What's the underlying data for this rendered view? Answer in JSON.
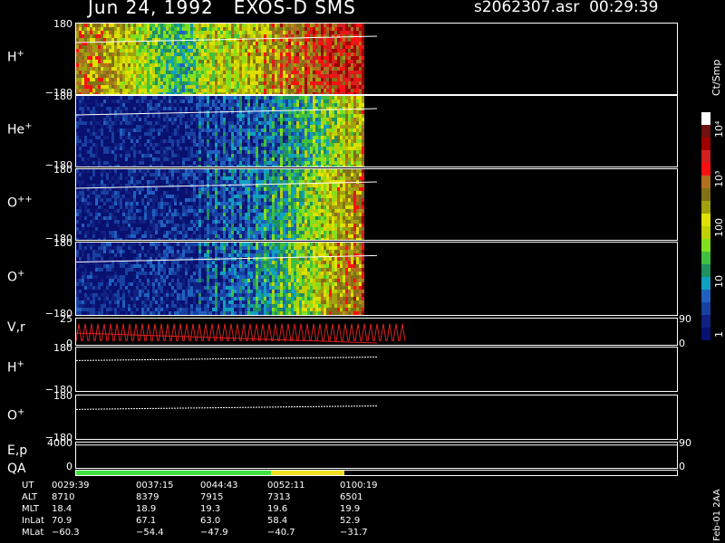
{
  "header": {
    "title": "Jun 24, 1992   EXOS-D SMS",
    "file": "s2062307.asr",
    "time": "00:29:39"
  },
  "panels": [
    {
      "id": "h-plus-top",
      "label": "H",
      "sup": "+",
      "ymax": "180",
      "ymin": "−180"
    },
    {
      "id": "he-plus",
      "label": "He",
      "sup": "+",
      "ymax": "180",
      "ymin": "−180"
    },
    {
      "id": "o-plusplus",
      "label": "O",
      "sup": "++",
      "ymax": "180",
      "ymin": "−180"
    },
    {
      "id": "o-plus-top",
      "label": "O",
      "sup": "+",
      "ymax": "180",
      "ymin": "−180"
    },
    {
      "id": "vr",
      "label": "V,r",
      "sup": "",
      "ymax": "25",
      "ymin": "0",
      "rmax": "90",
      "rmin": "0"
    },
    {
      "id": "h-plus-bot",
      "label": "H",
      "sup": "+",
      "ymax": "180",
      "ymin": "−180"
    },
    {
      "id": "o-plus-bot",
      "label": "O",
      "sup": "+",
      "ymax": "180",
      "ymin": "−180"
    },
    {
      "id": "ep",
      "label": "E,p",
      "sup": "",
      "ymax": "4000",
      "ymin": "0",
      "rmax": "90",
      "rmin": "0"
    },
    {
      "id": "qa",
      "label": "QA",
      "sup": "",
      "ymax": "",
      "ymin": ""
    }
  ],
  "colorbar": {
    "unit": "Ct/Smp",
    "ticks": [
      "10⁴",
      "10³",
      "100",
      "10",
      "1"
    ],
    "colors": [
      "#ffffff",
      "#701010",
      "#a00000",
      "#d02020",
      "#ff1010",
      "#b07020",
      "#807018",
      "#a0a010",
      "#e0e000",
      "#c0d000",
      "#80e020",
      "#40c040",
      "#209060",
      "#10a0c0",
      "#2060c0",
      "#1840a0",
      "#102080",
      "#081070"
    ]
  },
  "chart_data": {
    "type": "heatmap",
    "title": "Jun 24, 1992   EXOS-D SMS",
    "x_axis": "UT",
    "x_ticks": [
      "0029:39",
      "0037:15",
      "0044:43",
      "0052:11",
      "0100:19"
    ],
    "x_range": [
      "0029:39",
      "0100:19"
    ],
    "data_end_fraction": 0.48,
    "line_end_fraction": 0.5,
    "panels_y_range": [
      -180,
      180
    ],
    "spectrogram_profiles": {
      "h-plus-top": [
        0.75,
        0.7,
        0.6,
        0.45,
        0.35,
        0.5,
        0.55,
        0.6,
        0.7,
        0.78,
        0.82,
        0.85
      ],
      "he-plus": [
        0.05,
        0.05,
        0.06,
        0.06,
        0.08,
        0.1,
        0.12,
        0.18,
        0.25,
        0.35,
        0.5,
        0.6
      ],
      "o-plusplus": [
        0.06,
        0.06,
        0.08,
        0.1,
        0.1,
        0.12,
        0.15,
        0.22,
        0.3,
        0.45,
        0.6,
        0.72
      ],
      "o-plus-top": [
        0.06,
        0.07,
        0.08,
        0.1,
        0.1,
        0.12,
        0.16,
        0.24,
        0.35,
        0.5,
        0.65,
        0.75
      ]
    },
    "qa_segments": [
      {
        "end_fraction": 0.325,
        "color": "#40e040"
      },
      {
        "end_fraction": 0.447,
        "color": "#f0e020"
      }
    ]
  },
  "ephemeris": {
    "rows": [
      {
        "label": "UT",
        "values": [
          "0029:39",
          "0037:15",
          "0044:43",
          "0052:11",
          "0100:19"
        ]
      },
      {
        "label": "ALT",
        "values": [
          "8710",
          "8379",
          "7915",
          "7313",
          "6501"
        ]
      },
      {
        "label": "MLT",
        "values": [
          "18.4",
          "18.9",
          "19.3",
          "19.6",
          "19.9"
        ]
      },
      {
        "label": "InLat",
        "values": [
          "70.9",
          "67.1",
          "63.0",
          "58.4",
          "52.9"
        ]
      },
      {
        "label": "MLat",
        "values": [
          "−60.3",
          "−54.4",
          "−47.9",
          "−40.7",
          "−31.7"
        ]
      }
    ]
  },
  "footer": {
    "stamp": "Feb-01 2AA"
  }
}
